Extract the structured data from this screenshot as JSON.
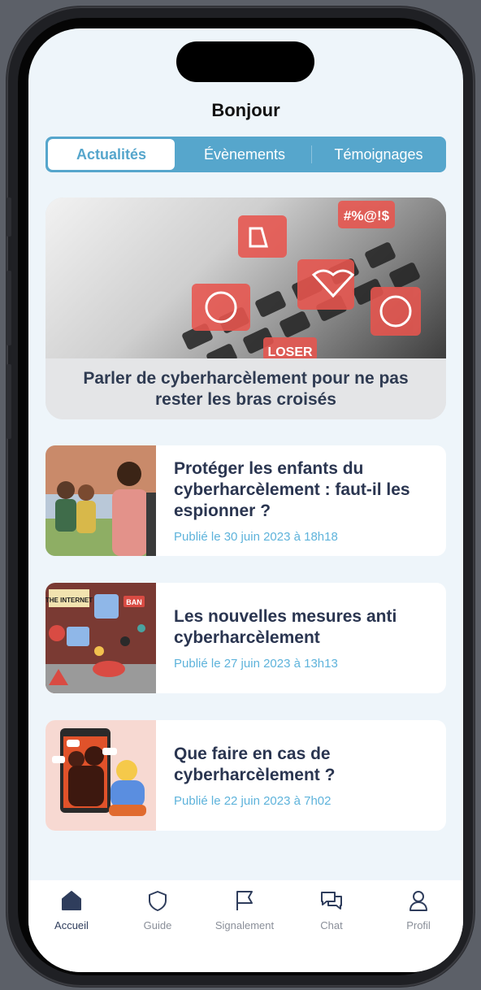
{
  "header": {
    "title": "Bonjour"
  },
  "tabs": [
    {
      "label": "Actualités",
      "active": true
    },
    {
      "label": "Évènements",
      "active": false
    },
    {
      "label": "Témoignages",
      "active": false
    }
  ],
  "featured": {
    "title": "Parler de cyberharcèlement pour ne pas rester les bras croisés",
    "overlay_texts": [
      "#%@!$",
      "LOSER"
    ]
  },
  "articles": [
    {
      "title": "Protéger les enfants du cyberharcèlement : faut-il les espionner ?",
      "date": "Publié le 30 juin 2023 à 18h18"
    },
    {
      "title": "Les nouvelles mesures anti cyberharcèlement",
      "date": "Publié le 27 juin 2023 à 13h13",
      "thumb_texts": [
        "THE INTERNET",
        "BAN"
      ]
    },
    {
      "title": "Que faire en cas de cyberharcèlement ?",
      "date": "Publié le 22 juin 2023 à 7h02"
    }
  ],
  "tabbar": [
    {
      "label": "Accueil",
      "icon": "home-icon",
      "active": true
    },
    {
      "label": "Guide",
      "icon": "shield-icon",
      "active": false
    },
    {
      "label": "Signalement",
      "icon": "flag-icon",
      "active": false
    },
    {
      "label": "Chat",
      "icon": "chat-icon",
      "active": false
    },
    {
      "label": "Profil",
      "icon": "user-icon",
      "active": false
    }
  ],
  "colors": {
    "accent": "#56a6cc",
    "navy": "#2f3d5c",
    "date": "#5eb3db",
    "alert": "#e8554e"
  }
}
